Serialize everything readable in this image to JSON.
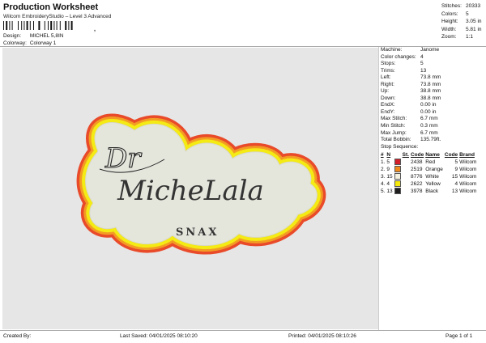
{
  "header": {
    "title": "Production Worksheet",
    "subtitle": "Wilcom EmbroideryStudio – Level 3 Advanced",
    "barcode_mark": ",",
    "design_label": "Design:",
    "design_value": "MICHEL 5,8IN",
    "colorway_label": "Colorway:",
    "colorway_value": "Colorway 1"
  },
  "stats": [
    {
      "label": "Stitches:",
      "value": "20333"
    },
    {
      "label": "Colors:",
      "value": "5"
    },
    {
      "label": "Height:",
      "value": "3.05 in"
    },
    {
      "label": "Width:",
      "value": "5.81 in"
    },
    {
      "label": "Zoom:",
      "value": "1:1"
    }
  ],
  "machine_info": [
    {
      "label": "Machine:",
      "value": "Janome"
    },
    {
      "label": "Color changes:",
      "value": "4"
    },
    {
      "label": "Stops:",
      "value": "5"
    },
    {
      "label": "Trims:",
      "value": "13"
    },
    {
      "label": "Left:",
      "value": "73.8 mm"
    },
    {
      "label": "Right:",
      "value": "73.8 mm"
    },
    {
      "label": "Up:",
      "value": "38.8 mm"
    },
    {
      "label": "Down:",
      "value": "38.8 mm"
    },
    {
      "label": "EndX:",
      "value": "0.00 in"
    },
    {
      "label": "EndY:",
      "value": "0.00 in"
    },
    {
      "label": "Max Stitch:",
      "value": "6.7 mm"
    },
    {
      "label": "Min Stitch:",
      "value": "0.3 mm"
    },
    {
      "label": "Max Jump:",
      "value": "6.7 mm"
    },
    {
      "label": "Total Bobbin:",
      "value": "135.79ft."
    }
  ],
  "sequence": {
    "title": "Stop Sequence:",
    "headers": [
      "#",
      "N",
      "St.",
      "Code",
      "Name",
      "Code",
      "Brand"
    ],
    "rows": [
      {
        "num": "1.",
        "n": "5",
        "st": "",
        "color": "#d3202a",
        "code": "2438",
        "name": "Red",
        "code2": "5",
        "brand": "Wilcom"
      },
      {
        "num": "2.",
        "n": "9",
        "st": "",
        "color": "#f08a1d",
        "code": "2519",
        "name": "Orange",
        "code2": "9",
        "brand": "Wilcom"
      },
      {
        "num": "3.",
        "n": "15",
        "st": "",
        "color": "#f4f1de",
        "code": "8776",
        "name": "White",
        "code2": "15",
        "brand": "Wilcom"
      },
      {
        "num": "4.",
        "n": "4",
        "st": "",
        "color": "#f5ea0c",
        "code": "2622",
        "name": "Yellow",
        "code2": "4",
        "brand": "Wilcom"
      },
      {
        "num": "5.",
        "n": "13",
        "st": "",
        "color": "#1e1e1e",
        "code": "3978",
        "name": "Black",
        "code2": "13",
        "brand": "Wilcom"
      }
    ]
  },
  "design": {
    "line1": "Dr",
    "line2": "MicheLala",
    "line3": "SNAX"
  },
  "footer": {
    "created_by": "Created By:",
    "last_saved": "Last Saved: 04/01/2025 08:10:20",
    "printed": "Printed: 04/01/2025 08:10:26",
    "page": "Page 1 of 1"
  }
}
